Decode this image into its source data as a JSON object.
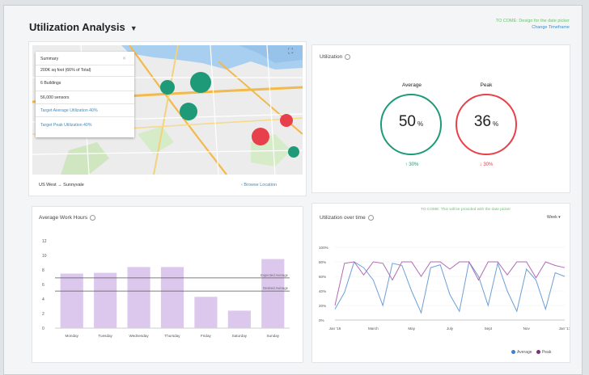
{
  "header": {
    "title": "Utilization Analysis",
    "todo_note": "TO COME: Design for the date picker",
    "change_link": "Change Timeframe"
  },
  "map": {
    "summary_heading": "Summary",
    "rows": [
      "200K sq foot (66% of Total)",
      "6 Buildings",
      "56,000 sensors"
    ],
    "target_avg": "Target Average Utilization 40%",
    "target_peak": "Target Peak Utilization 40%",
    "location": "US West → Sunnyvale",
    "browse": "Browse Location",
    "bubbles": [
      {
        "color": "#1e9a78"
      },
      {
        "color": "#1e9a78"
      },
      {
        "color": "#1e9a78"
      },
      {
        "color": "#e8404a"
      },
      {
        "color": "#e8404a"
      },
      {
        "color": "#1e9a78"
      }
    ]
  },
  "utilization": {
    "title": "Utilization",
    "average": {
      "label": "Average",
      "value": "50",
      "unit": "%",
      "delta": "↑ 30%",
      "color": "#1e9a78"
    },
    "peak": {
      "label": "Peak",
      "value": "36",
      "unit": "%",
      "delta": "↓ 30%",
      "color": "#e8404a"
    }
  },
  "work_hours": {
    "title": "Average Work Hours",
    "chart_data": {
      "type": "bar",
      "categories": [
        "Monday",
        "Tuesday",
        "Wednesday",
        "Thursday",
        "Friday",
        "Saturday",
        "Sunday"
      ],
      "values": [
        7.5,
        7.6,
        8.4,
        8.4,
        4.3,
        2.4,
        9.5
      ],
      "ylim": [
        0,
        12
      ],
      "yticks": [
        "12",
        "10",
        "8",
        "6",
        "4",
        "2",
        "0"
      ],
      "ref_lines": [
        {
          "label": "Expected Average",
          "value": 6.9
        },
        {
          "label": "Desired Average",
          "value": 5.1
        }
      ],
      "bar_color": "#dcc8ec"
    }
  },
  "util_time": {
    "title": "Utilization over time",
    "todo": "TO COME: This will be provided with the date picker",
    "range": "Week",
    "chart_data": {
      "type": "line",
      "x": [
        "Jan '16",
        "March",
        "May",
        "July",
        "Sept",
        "Nov",
        "Jan '17"
      ],
      "yticks": [
        "100%",
        "80%",
        "60%",
        "40%",
        "20%",
        "0%"
      ],
      "ylim": [
        0,
        100
      ],
      "series": [
        {
          "name": "Average",
          "color": "#6c9fd6",
          "values": [
            15,
            38,
            80,
            72,
            55,
            20,
            78,
            75,
            40,
            10,
            72,
            76,
            35,
            12,
            80,
            60,
            20,
            78,
            40,
            12,
            70,
            55,
            15,
            65,
            60
          ]
        },
        {
          "name": "Peak",
          "color": "#b06ab3",
          "values": [
            20,
            78,
            80,
            62,
            80,
            78,
            55,
            80,
            80,
            60,
            80,
            80,
            70,
            80,
            80,
            55,
            80,
            80,
            62,
            80,
            80,
            58,
            80,
            75,
            72
          ]
        }
      ]
    }
  }
}
